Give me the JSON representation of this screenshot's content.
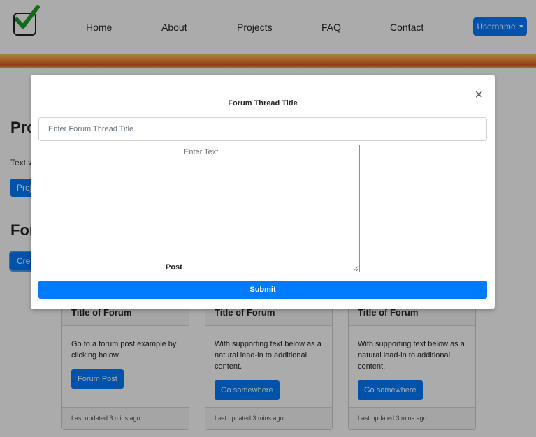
{
  "nav": {
    "links": [
      "Home",
      "About",
      "Projects",
      "FAQ",
      "Contact"
    ],
    "user_label": "Username"
  },
  "page": {
    "projects_heading": "Pro",
    "text_partial": "Text w",
    "projects_button": "Proj",
    "forum_heading": "For",
    "create_button": "Cre"
  },
  "cards": [
    {
      "title": "Title of Forum",
      "text": "Go to a forum post example by clicking below",
      "button": "Forum Post",
      "footer": "Last updated 3 mins ago"
    },
    {
      "title": "Title of Forum",
      "text": "With supporting text below as a natural lead-in to additional content.",
      "button": "Go somewhere",
      "footer": "Last updated 3 mins ago"
    },
    {
      "title": "Title of Forum",
      "text": "With supporting text below as a natural lead-in to additional content.",
      "button": "Go somewhere",
      "footer": "Last updated 3 mins ago"
    }
  ],
  "modal": {
    "close_symbol": "×",
    "title_label": "Forum Thread Title",
    "title_placeholder": "Enter Forum Thread Title",
    "post_label": "Post",
    "post_placeholder": "Enter Text",
    "submit_label": "Submit"
  },
  "colors": {
    "primary": "#007bff",
    "backdrop": "rgba(0,0,0,0.33)"
  },
  "icons": {
    "logo": "checkmark-logo-icon",
    "close": "close-icon",
    "dropdown": "caret-down-icon"
  }
}
